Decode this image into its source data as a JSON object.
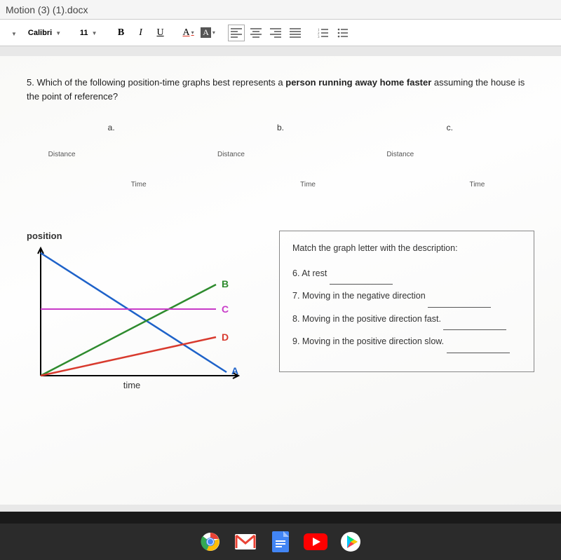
{
  "titlebar": {
    "filename": "Motion (3) (1).docx"
  },
  "toolbar": {
    "font_name": "Calibri",
    "font_size": "11",
    "bold": "B",
    "italic": "I",
    "underline": "U",
    "text_color": "A",
    "highlight": "A"
  },
  "question5": {
    "prefix": "5. Which of the following position-time graphs best represents a ",
    "bold": "person running away home faster",
    "suffix": " assuming the house is the point of reference?"
  },
  "options": {
    "a": "a.",
    "b": "b.",
    "c": "c.",
    "y_label": "Distance",
    "x_label": "Time"
  },
  "chart": {
    "y_axis": "position",
    "x_axis": "time",
    "series_labels": {
      "A": "A",
      "B": "B",
      "C": "C",
      "D": "D"
    }
  },
  "match": {
    "header": "Match the graph letter with the description:",
    "q6": "6. At rest",
    "q7": "7. Moving in the negative direction",
    "q8": "8. Moving in the positive direction fast.",
    "q9": "9. Moving in the positive direction slow."
  },
  "chart_data": {
    "type": "line",
    "xlabel": "time",
    "ylabel": "position",
    "xlim": [
      0,
      10
    ],
    "ylim": [
      0,
      10
    ],
    "series": [
      {
        "name": "A",
        "color": "#1E62C9",
        "x": [
          0,
          10
        ],
        "y": [
          10,
          0
        ]
      },
      {
        "name": "B",
        "color": "#2E8B2E",
        "x": [
          0,
          10
        ],
        "y": [
          0,
          7
        ]
      },
      {
        "name": "C",
        "color": "#C83AC8",
        "x": [
          0,
          10
        ],
        "y": [
          5,
          5
        ]
      },
      {
        "name": "D",
        "color": "#D83A2E",
        "x": [
          0,
          10
        ],
        "y": [
          0,
          3
        ]
      }
    ]
  }
}
